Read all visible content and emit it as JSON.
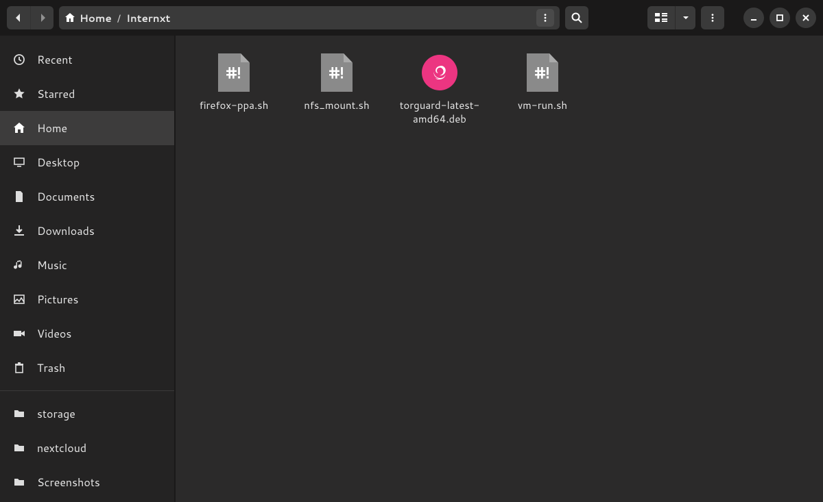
{
  "breadcrumb": {
    "home_label": "Home",
    "current": "Internxt"
  },
  "sidebar": {
    "items": [
      {
        "id": "recent",
        "label": "Recent",
        "icon": "clock",
        "active": false
      },
      {
        "id": "starred",
        "label": "Starred",
        "icon": "star",
        "active": false
      },
      {
        "id": "home",
        "label": "Home",
        "icon": "home",
        "active": true
      },
      {
        "id": "desktop",
        "label": "Desktop",
        "icon": "desktop",
        "active": false
      },
      {
        "id": "documents",
        "label": "Documents",
        "icon": "document",
        "active": false
      },
      {
        "id": "downloads",
        "label": "Downloads",
        "icon": "download",
        "active": false
      },
      {
        "id": "music",
        "label": "Music",
        "icon": "music",
        "active": false
      },
      {
        "id": "pictures",
        "label": "Pictures",
        "icon": "picture",
        "active": false
      },
      {
        "id": "videos",
        "label": "Videos",
        "icon": "video",
        "active": false
      },
      {
        "id": "trash",
        "label": "Trash",
        "icon": "trash",
        "active": false
      }
    ],
    "bookmarks": [
      {
        "id": "storage",
        "label": "storage",
        "icon": "folder"
      },
      {
        "id": "nextcloud",
        "label": "nextcloud",
        "icon": "folder"
      },
      {
        "id": "screenshots",
        "label": "Screenshots",
        "icon": "folder"
      }
    ]
  },
  "files": [
    {
      "name": "firefox-ppa.sh",
      "type": "script",
      "icon_text": "#!"
    },
    {
      "name": "nfs_mount.sh",
      "type": "script",
      "icon_text": "#!"
    },
    {
      "name": "torguard-latest-amd64.deb",
      "type": "deb"
    },
    {
      "name": "vm-run.sh",
      "type": "script",
      "icon_text": "#!"
    }
  ]
}
